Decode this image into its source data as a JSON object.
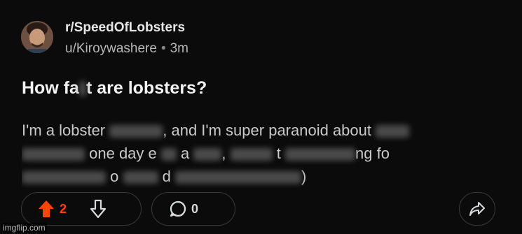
{
  "post": {
    "subreddit": "r/SpeedOfLobsters",
    "author": "u/Kiroywashere",
    "separator": "•",
    "age": "3m",
    "title_part1": "How fa",
    "title_part2": "t are lobsters?",
    "body": {
      "line1_a": "I'm a lobster",
      "line1_b": ", and I'm super paranoid about",
      "line2_a": "one day e",
      "line2_b": "a",
      "line2_c": ",",
      "line2_d": "t",
      "line2_e": "ng fo",
      "line3_a": "o",
      "line3_b": "d",
      "line3_c": ")"
    }
  },
  "actions": {
    "upvote_count": "2",
    "comment_count": "0"
  },
  "colors": {
    "accent": "#ff4500",
    "background": "#0b0b0b"
  },
  "watermark": "imgflip.com"
}
